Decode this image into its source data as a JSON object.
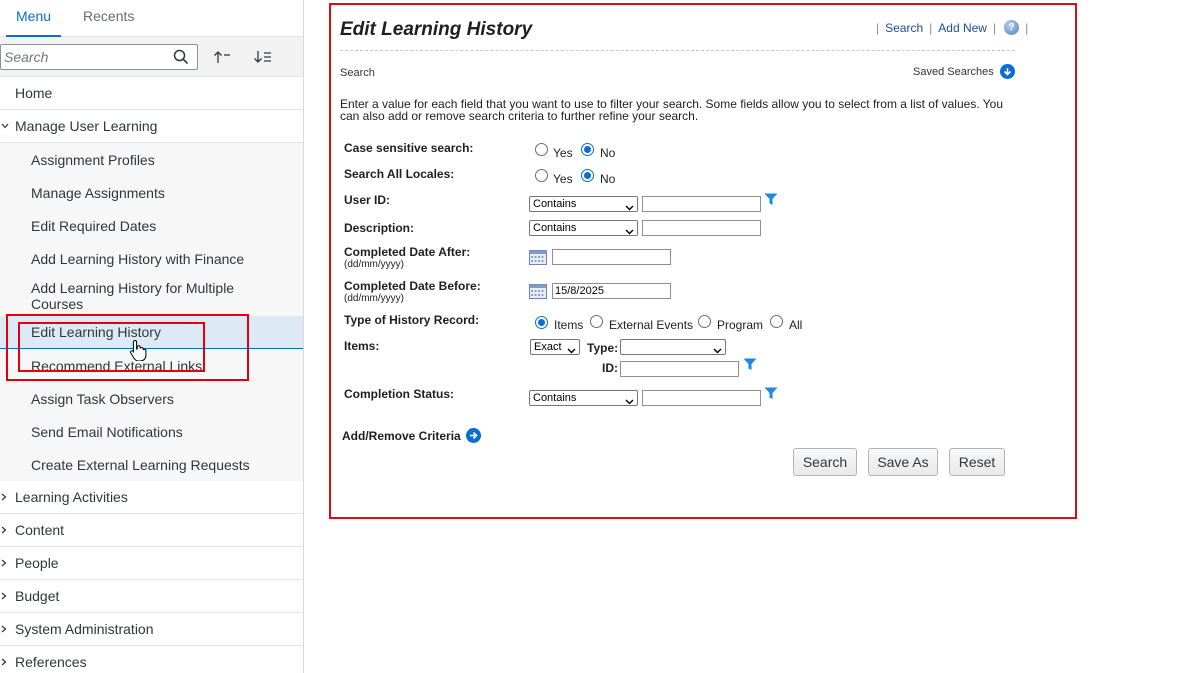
{
  "sidebar": {
    "tabs": [
      {
        "label": "Menu",
        "active": true
      },
      {
        "label": "Recents",
        "active": false
      }
    ],
    "search_placeholder": "Search",
    "nav": [
      {
        "label": "Home",
        "type": "leaf"
      },
      {
        "label": "Manage User Learning",
        "type": "expanded",
        "children": [
          "Assignment Profiles",
          "Manage Assignments",
          "Edit Required Dates",
          "Add Learning History with Finance",
          "Add Learning History for Multiple Courses",
          "Edit Learning History",
          "Recommend External Links",
          "Assign Task Observers",
          "Send Email Notifications",
          "Create External Learning Requests"
        ]
      },
      {
        "label": "Learning Activities",
        "type": "collapsed"
      },
      {
        "label": "Content",
        "type": "collapsed"
      },
      {
        "label": "People",
        "type": "collapsed"
      },
      {
        "label": "Budget",
        "type": "collapsed"
      },
      {
        "label": "System Administration",
        "type": "collapsed"
      },
      {
        "label": "References",
        "type": "collapsed"
      }
    ],
    "selected_item": "Edit Learning History"
  },
  "main": {
    "title": "Edit Learning History",
    "header_links": {
      "search": "Search",
      "add_new": "Add New",
      "help": "?"
    },
    "section_label": "Search",
    "saved_searches": "Saved Searches",
    "instructions": "Enter a value for each field that you want to use to filter your search. Some fields allow you to select from a list of values. You can also add or remove search criteria to further refine your search.",
    "fields": {
      "case_sensitive": {
        "label": "Case sensitive search:",
        "yes": "Yes",
        "no": "No",
        "selected": "No"
      },
      "all_locales": {
        "label": "Search All Locales:",
        "yes": "Yes",
        "no": "No",
        "selected": "No"
      },
      "user_id": {
        "label": "User ID:",
        "operator": "Contains",
        "value": ""
      },
      "description": {
        "label": "Description:",
        "operator": "Contains",
        "value": ""
      },
      "completed_after": {
        "label": "Completed Date After:",
        "format": "(dd/mm/yyyy)",
        "value": ""
      },
      "completed_before": {
        "label": "Completed Date Before:",
        "format": "(dd/mm/yyyy)",
        "value": "15/8/2025"
      },
      "history_type": {
        "label": "Type of History Record:",
        "options": [
          "Items",
          "External Events",
          "Program",
          "All"
        ],
        "selected": "Items"
      },
      "items": {
        "label": "Items:",
        "operator": "Exact",
        "type_label": "Type:",
        "type_value": "",
        "id_label": "ID:",
        "id_value": ""
      },
      "completion_status": {
        "label": "Completion Status:",
        "operator": "Contains",
        "value": ""
      }
    },
    "criteria_link": "Add/Remove Criteria",
    "buttons": {
      "search": "Search",
      "save_as": "Save As",
      "reset": "Reset"
    }
  },
  "colors": {
    "accent": "#0a6ed1",
    "highlight_border": "#e2000f",
    "selected_bg": "#dde9f5"
  }
}
